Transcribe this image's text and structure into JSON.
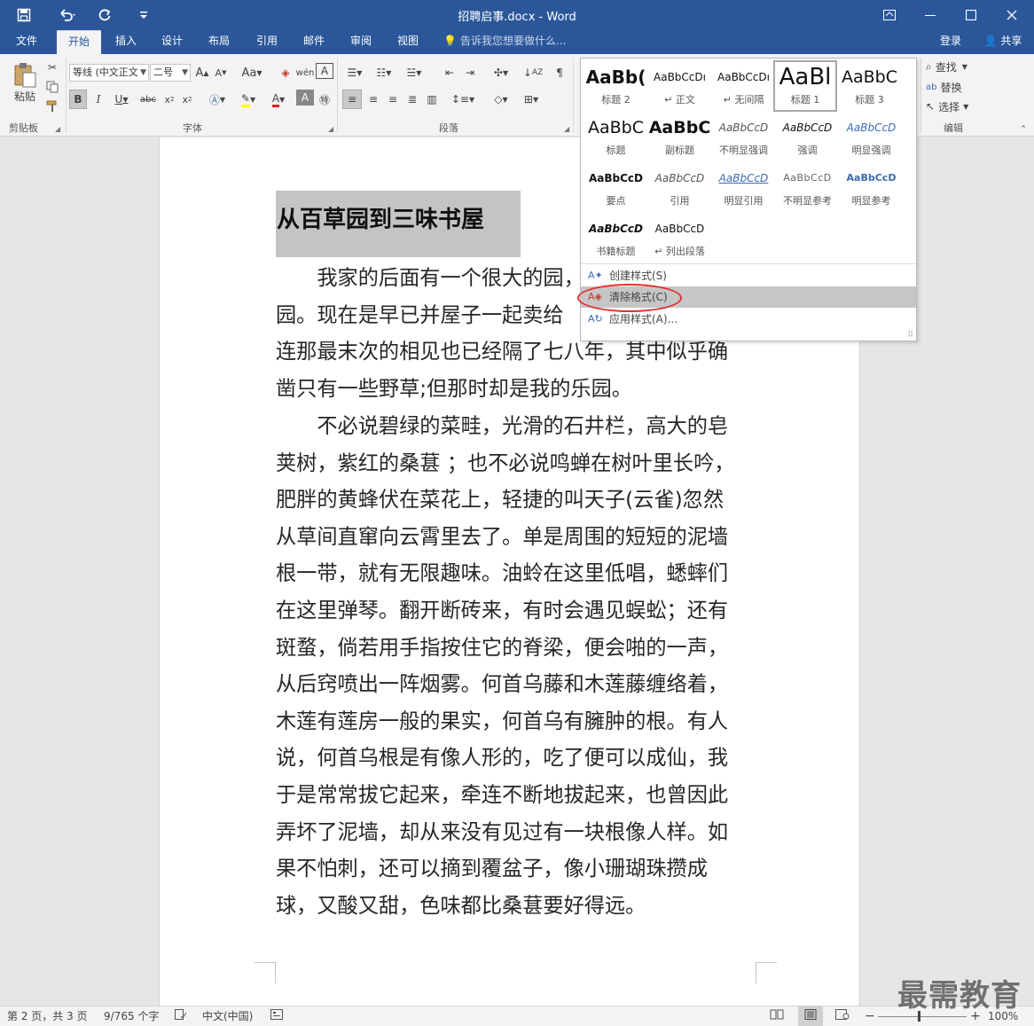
{
  "titlebar": {
    "title": "招聘启事.docx - Word",
    "save_icon": "save-icon",
    "undo_icon": "undo-icon",
    "redo_icon": "redo-icon"
  },
  "tabs": [
    "文件",
    "开始",
    "插入",
    "设计",
    "布局",
    "引用",
    "邮件",
    "审阅",
    "视图"
  ],
  "active_tab": "开始",
  "tell_me": "告诉我您想要做什么...",
  "account": {
    "login": "登录",
    "share": "共享"
  },
  "ribbon": {
    "clipboard": {
      "paste": "粘贴",
      "group": "剪贴板"
    },
    "font": {
      "font_name": "等线 (中文正文",
      "font_size": "二号",
      "group": "字体"
    },
    "paragraph": {
      "group": "段落"
    },
    "editing": {
      "find": "查找",
      "replace": "替换",
      "select": "选择",
      "group": "编辑"
    }
  },
  "style_gallery": {
    "styles": [
      {
        "preview": "AaBb(",
        "name": "标题 2"
      },
      {
        "preview": "AaBbCcDı",
        "name": "↵ 正文"
      },
      {
        "preview": "AaBbCcDı",
        "name": "↵ 无间隔"
      },
      {
        "preview": "AaBl",
        "name": "标题 1"
      },
      {
        "preview": "AaBbC",
        "name": "标题 3"
      },
      {
        "preview": "AaBbC",
        "name": "标题"
      },
      {
        "preview": "AaBbC",
        "name": "副标题"
      },
      {
        "preview": "AaBbCcD",
        "name": "不明显强调"
      },
      {
        "preview": "AaBbCcD",
        "name": "强调"
      },
      {
        "preview": "AaBbCcD",
        "name": "明显强调"
      },
      {
        "preview": "AaBbCcD",
        "name": "要点"
      },
      {
        "preview": "AaBbCcD",
        "name": "引用"
      },
      {
        "preview": "AaBbCcD",
        "name": "明显引用"
      },
      {
        "preview": "AaBbCcD",
        "name": "不明显参考"
      },
      {
        "preview": "AaBbCcD",
        "name": "明显参考"
      },
      {
        "preview": "AaBbCcD",
        "name": "书籍标题"
      },
      {
        "preview": "AaBbCcD",
        "name": "↵ 列出段落"
      }
    ],
    "menu": {
      "create": "创建样式(S)",
      "clear": "清除格式(C)",
      "apply": "应用样式(A)..."
    }
  },
  "document": {
    "heading": "从百草园到三味书屋",
    "paragraph1_lines": [
      "　　我家的后面有一个很大的园，",
      "园。现在是早已并屋子一起卖给",
      "连那最末次的相见也已经隔了七八年，其中似乎确",
      "凿只有一些野草;但那时却是我的乐园。"
    ],
    "paragraph2_lines": [
      "　　不必说碧绿的菜畦，光滑的石井栏，高大的皂",
      "荚树，紫红的桑葚 ；也不必说鸣蝉在树叶里长吟，",
      "肥胖的黄蜂伏在菜花上，轻捷的叫天子(云雀)忽然",
      "从草间直窜向云霄里去了。单是周围的短短的泥墙",
      "根一带，就有无限趣味。油蛉在这里低唱，蟋蟀们",
      "在这里弹琴。翻开断砖来，有时会遇见蜈蚣；还有",
      "斑蝥，倘若用手指按住它的脊梁，便会啪的一声，",
      "从后窍喷出一阵烟雾。何首乌藤和木莲藤缠络着，",
      "木莲有莲房一般的果实，何首乌有臃肿的根。有人",
      "说，何首乌根是有像人形的，吃了便可以成仙，我",
      "于是常常拔它起来，牵连不断地拔起来，也曾因此",
      "弄坏了泥墙，却从来没有见过有一块根像人样。如",
      "果不怕刺，还可以摘到覆盆子，像小珊瑚珠攒成",
      "球，又酸又甜，色味都比桑葚要好得远。"
    ]
  },
  "statusbar": {
    "page": "第 2 页，共 3 页",
    "words": "9/765 个字",
    "language": "中文(中国)",
    "zoom": "100%"
  },
  "watermark": "最需教育",
  "colors": {
    "accent": "#2b579a",
    "highlight_oval": "#e03232"
  }
}
